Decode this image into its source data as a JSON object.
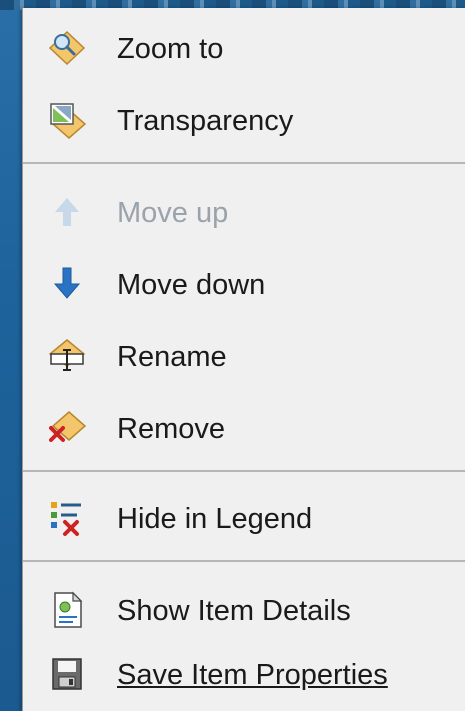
{
  "menu": {
    "items": [
      {
        "label": "Zoom to",
        "icon": "zoom-to-icon"
      },
      {
        "label": "Transparency",
        "icon": "transparency-icon"
      },
      {
        "label": "Move up",
        "icon": "arrow-up-icon",
        "disabled": true
      },
      {
        "label": "Move down",
        "icon": "arrow-down-icon"
      },
      {
        "label": "Rename",
        "icon": "rename-icon"
      },
      {
        "label": "Remove",
        "icon": "remove-icon"
      },
      {
        "label": "Hide in Legend",
        "icon": "hide-legend-icon"
      },
      {
        "label": "Show Item Details",
        "icon": "details-icon"
      },
      {
        "label": "Save Item Properties",
        "icon": "save-icon",
        "underlined": true
      }
    ]
  },
  "colors": {
    "menu_bg": "#f0f0f0",
    "desktop_bg": "#1e639c",
    "arrow_blue": "#2a73c4",
    "remove_red": "#cc2222"
  }
}
